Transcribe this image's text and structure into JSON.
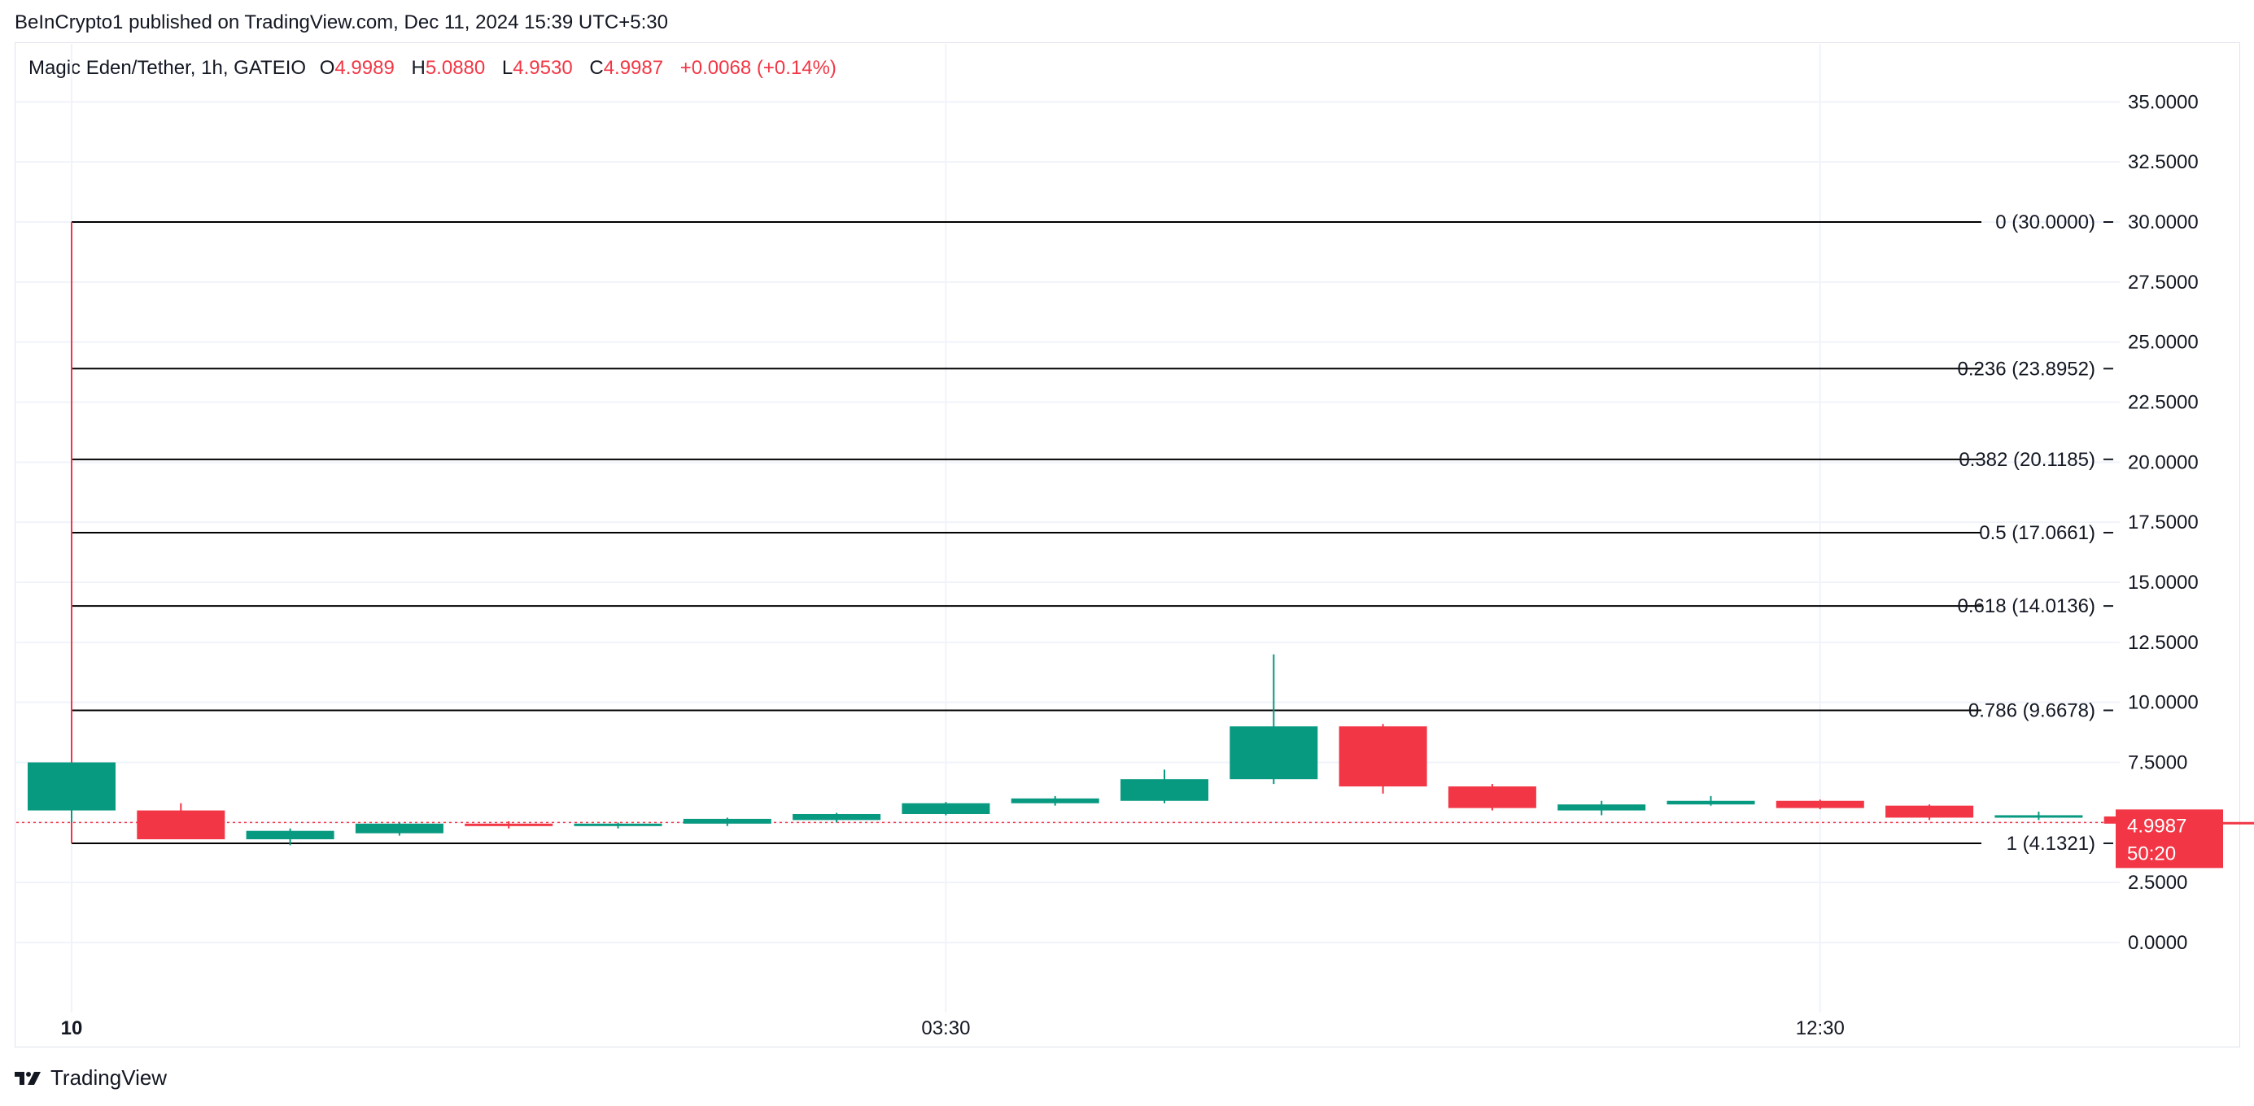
{
  "header": {
    "published": "BeInCrypto1 published on TradingView.com, Dec 11, 2024 15:39 UTC+5:30"
  },
  "legend": {
    "symbol": "Magic Eden/Tether, 1h, GATEIO",
    "o_label": "O",
    "o_value": "4.9989",
    "h_label": "H",
    "h_value": "5.0880",
    "l_label": "L",
    "l_value": "4.9530",
    "c_label": "C",
    "c_value": "4.9987",
    "change": "+0.0068 (+0.14%)"
  },
  "brand": {
    "name": "TradingView",
    "icon": "tradingview-logo-icon"
  },
  "price_tag": {
    "price": "4.9987",
    "countdown": "50:20",
    "color": "#f23645"
  },
  "colors": {
    "up": "#089981",
    "down": "#f23645",
    "grid": "#f0f3fa",
    "fib": "#000000",
    "text": "#131722"
  },
  "chart_data": {
    "type": "candlestick",
    "ylim": [
      -3,
      36
    ],
    "y_ticks": [
      "35.0000",
      "32.5000",
      "30.0000",
      "27.5000",
      "25.0000",
      "22.5000",
      "20.0000",
      "17.5000",
      "15.0000",
      "12.5000",
      "10.0000",
      "7.5000",
      "5.0000",
      "2.5000",
      "0.0000"
    ],
    "y_tick_values": [
      35,
      32.5,
      30,
      27.5,
      25,
      22.5,
      20,
      17.5,
      15,
      12.5,
      10,
      7.5,
      5,
      2.5,
      0
    ],
    "x_ticks": [
      {
        "label": "10",
        "index": 0,
        "bold": true
      },
      {
        "label": "03:30",
        "index": 8,
        "bold": false
      },
      {
        "label": "12:30",
        "index": 16,
        "bold": false
      }
    ],
    "candles": [
      {
        "o": 5.5,
        "h": 30.0,
        "l": 5.0,
        "c": 7.5
      },
      {
        "o": 5.5,
        "h": 5.8,
        "l": 4.3,
        "c": 4.3
      },
      {
        "o": 4.3,
        "h": 4.75,
        "l": 4.05,
        "c": 4.65
      },
      {
        "o": 4.55,
        "h": 5.0,
        "l": 4.45,
        "c": 4.95
      },
      {
        "o": 4.95,
        "h": 5.05,
        "l": 4.75,
        "c": 4.85
      },
      {
        "o": 4.85,
        "h": 5.0,
        "l": 4.75,
        "c": 4.95
      },
      {
        "o": 4.95,
        "h": 5.2,
        "l": 4.85,
        "c": 5.15
      },
      {
        "o": 5.1,
        "h": 5.4,
        "l": 5.0,
        "c": 5.35
      },
      {
        "o": 5.35,
        "h": 5.85,
        "l": 5.3,
        "c": 5.8
      },
      {
        "o": 5.8,
        "h": 6.1,
        "l": 5.7,
        "c": 6.0
      },
      {
        "o": 5.9,
        "h": 7.2,
        "l": 5.8,
        "c": 6.8
      },
      {
        "o": 6.8,
        "h": 12.0,
        "l": 6.6,
        "c": 9.0
      },
      {
        "o": 9.0,
        "h": 9.1,
        "l": 6.2,
        "c": 6.5
      },
      {
        "o": 6.5,
        "h": 6.6,
        "l": 5.5,
        "c": 5.6
      },
      {
        "o": 5.5,
        "h": 5.9,
        "l": 5.3,
        "c": 5.75
      },
      {
        "o": 5.75,
        "h": 6.1,
        "l": 5.7,
        "c": 5.9
      },
      {
        "o": 5.9,
        "h": 5.95,
        "l": 5.55,
        "c": 5.6
      },
      {
        "o": 5.7,
        "h": 5.75,
        "l": 5.1,
        "c": 5.2
      },
      {
        "o": 5.2,
        "h": 5.45,
        "l": 5.1,
        "c": 5.3
      },
      {
        "o": 5.25,
        "h": 5.3,
        "l": 4.95,
        "c": 4.95
      },
      {
        "o": 5.02,
        "h": 5.09,
        "l": 4.95,
        "c": 4.9987
      }
    ],
    "fib_levels": [
      {
        "label": "0 (30.0000)",
        "value": 30.0
      },
      {
        "label": "0.236 (23.8952)",
        "value": 23.8952
      },
      {
        "label": "0.382 (20.1185)",
        "value": 20.1185
      },
      {
        "label": "0.5 (17.0661)",
        "value": 17.0661
      },
      {
        "label": "0.618 (14.0136)",
        "value": 14.0136
      },
      {
        "label": "0.786 (9.6678)",
        "value": 9.6678
      },
      {
        "label": "1 (4.1321)",
        "value": 4.1321
      }
    ],
    "last_price": 4.9987
  }
}
